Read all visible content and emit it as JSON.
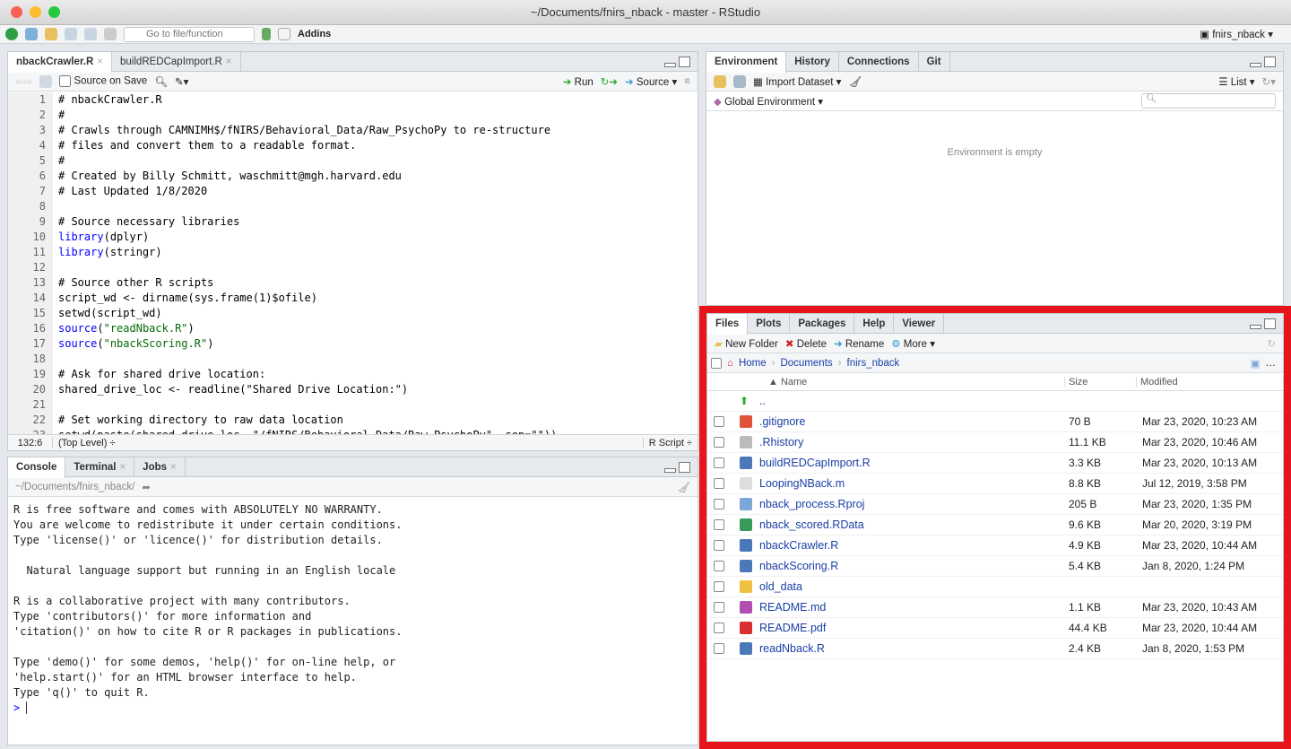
{
  "window": {
    "title": "~/Documents/fnirs_nback - master - RStudio"
  },
  "toolbar": {
    "goto_placeholder": "Go to file/function",
    "addins": "Addins",
    "project": "fnirs_nback"
  },
  "editor": {
    "tabs": [
      {
        "label": "nbackCrawler.R"
      },
      {
        "label": "buildREDCapImport.R"
      }
    ],
    "source_on_save": "Source on Save",
    "run": "Run",
    "source": "Source",
    "lines": [
      {
        "n": "1",
        "t": "# nbackCrawler.R",
        "k": "cm"
      },
      {
        "n": "2",
        "t": "#",
        "k": "cm"
      },
      {
        "n": "3",
        "t": "# Crawls through CAMNIMH$/fNIRS/Behavioral_Data/Raw_PsychoPy to re-structure",
        "k": "cm"
      },
      {
        "n": "4",
        "t": "# files and convert them to a readable format.",
        "k": "cm"
      },
      {
        "n": "5",
        "t": "#",
        "k": "cm"
      },
      {
        "n": "6",
        "t": "# Created by Billy Schmitt, waschmitt@mgh.harvard.edu",
        "k": "cm"
      },
      {
        "n": "7",
        "t": "# Last Updated 1/8/2020",
        "k": "cm"
      },
      {
        "n": "8",
        "t": "",
        "k": ""
      },
      {
        "n": "9",
        "t": "# Source necessary libraries",
        "k": "cm"
      },
      {
        "n": "10",
        "t": "library(dplyr)",
        "k": "lib"
      },
      {
        "n": "11",
        "t": "library(stringr)",
        "k": "lib"
      },
      {
        "n": "12",
        "t": "",
        "k": ""
      },
      {
        "n": "13",
        "t": "# Source other R scripts",
        "k": "cm"
      },
      {
        "n": "14",
        "t": "script_wd <- dirname(sys.frame(1)$ofile)",
        "k": ""
      },
      {
        "n": "15",
        "t": "setwd(script_wd)",
        "k": ""
      },
      {
        "n": "16",
        "t": "source(\"readNback.R\")",
        "k": "src"
      },
      {
        "n": "17",
        "t": "source(\"nbackScoring.R\")",
        "k": "src"
      },
      {
        "n": "18",
        "t": "",
        "k": ""
      },
      {
        "n": "19",
        "t": "# Ask for shared drive location:",
        "k": "cm"
      },
      {
        "n": "20",
        "t": "shared_drive_loc <- readline(\"Shared Drive Location:\")",
        "k": ""
      },
      {
        "n": "21",
        "t": "",
        "k": ""
      },
      {
        "n": "22",
        "t": "# Set working directory to raw data location",
        "k": "cm"
      },
      {
        "n": "23",
        "t": "setwd(paste(shared_drive_loc, \"/fNIRS/Behavioral_Data/Raw_PsychoPy\", sep=\"\"))",
        "k": ""
      }
    ],
    "status": {
      "position": "132:6",
      "scope": "(Top Level)",
      "type": "R Script"
    }
  },
  "console": {
    "tabs": [
      {
        "label": "Console"
      },
      {
        "label": "Terminal"
      },
      {
        "label": "Jobs"
      }
    ],
    "path": "~/Documents/fnirs_nback/",
    "text": "R is free software and comes with ABSOLUTELY NO WARRANTY.\nYou are welcome to redistribute it under certain conditions.\nType 'license()' or 'licence()' for distribution details.\n\n  Natural language support but running in an English locale\n\nR is a collaborative project with many contributors.\nType 'contributors()' for more information and\n'citation()' on how to cite R or R packages in publications.\n\nType 'demo()' for some demos, 'help()' for on-line help, or\n'help.start()' for an HTML browser interface to help.\nType 'q()' to quit R.\n",
    "prompt": ">"
  },
  "environment": {
    "tabs": [
      {
        "label": "Environment"
      },
      {
        "label": "History"
      },
      {
        "label": "Connections"
      },
      {
        "label": "Git"
      }
    ],
    "import": "Import Dataset",
    "list": "List",
    "scope": "Global Environment",
    "empty": "Environment is empty"
  },
  "files": {
    "tabs": [
      {
        "label": "Files"
      },
      {
        "label": "Plots"
      },
      {
        "label": "Packages"
      },
      {
        "label": "Help"
      },
      {
        "label": "Viewer"
      }
    ],
    "new_folder": "New Folder",
    "delete": "Delete",
    "rename": "Rename",
    "more": "More",
    "breadcrumb": [
      "Home",
      "Documents",
      "fnirs_nback"
    ],
    "columns": {
      "name": "Name",
      "size": "Size",
      "modified": "Modified"
    },
    "parent": "..",
    "rows": [
      {
        "name": ".gitignore",
        "size": "70 B",
        "modified": "Mar 23, 2020, 10:23 AM",
        "icon": "git-file-icon",
        "color": "#e0533a"
      },
      {
        "name": ".Rhistory",
        "size": "11.1 KB",
        "modified": "Mar 23, 2020, 10:46 AM",
        "icon": "history-file-icon",
        "color": "#bbbbbb"
      },
      {
        "name": "buildREDCapImport.R",
        "size": "3.3 KB",
        "modified": "Mar 23, 2020, 10:13 AM",
        "icon": "r-script-icon",
        "color": "#4a78b8"
      },
      {
        "name": "LoopingNBack.m",
        "size": "8.8 KB",
        "modified": "Jul 12, 2019, 3:58 PM",
        "icon": "matlab-file-icon",
        "color": "#dddddd"
      },
      {
        "name": "nback_process.Rproj",
        "size": "205 B",
        "modified": "Mar 23, 2020, 1:35 PM",
        "icon": "rproj-icon",
        "color": "#7aa6d8"
      },
      {
        "name": "nback_scored.RData",
        "size": "9.6 KB",
        "modified": "Mar 20, 2020, 3:19 PM",
        "icon": "rdata-icon",
        "color": "#3a9a5a"
      },
      {
        "name": "nbackCrawler.R",
        "size": "4.9 KB",
        "modified": "Mar 23, 2020, 10:44 AM",
        "icon": "r-script-icon",
        "color": "#4a78b8"
      },
      {
        "name": "nbackScoring.R",
        "size": "5.4 KB",
        "modified": "Jan 8, 2020, 1:24 PM",
        "icon": "r-script-icon",
        "color": "#4a78b8"
      },
      {
        "name": "old_data",
        "size": "",
        "modified": "",
        "icon": "folder-icon",
        "color": "#f0c040"
      },
      {
        "name": "README.md",
        "size": "1.1 KB",
        "modified": "Mar 23, 2020, 10:43 AM",
        "icon": "markdown-file-icon",
        "color": "#b04fb0"
      },
      {
        "name": "README.pdf",
        "size": "44.4 KB",
        "modified": "Mar 23, 2020, 10:44 AM",
        "icon": "pdf-file-icon",
        "color": "#d83030"
      },
      {
        "name": "readNback.R",
        "size": "2.4 KB",
        "modified": "Jan 8, 2020, 1:53 PM",
        "icon": "r-script-icon",
        "color": "#4a78b8"
      }
    ]
  },
  "colors": {
    "highlight_frame": "#e8141c",
    "link": "#1a3fa6",
    "comment": "#4c886b"
  }
}
